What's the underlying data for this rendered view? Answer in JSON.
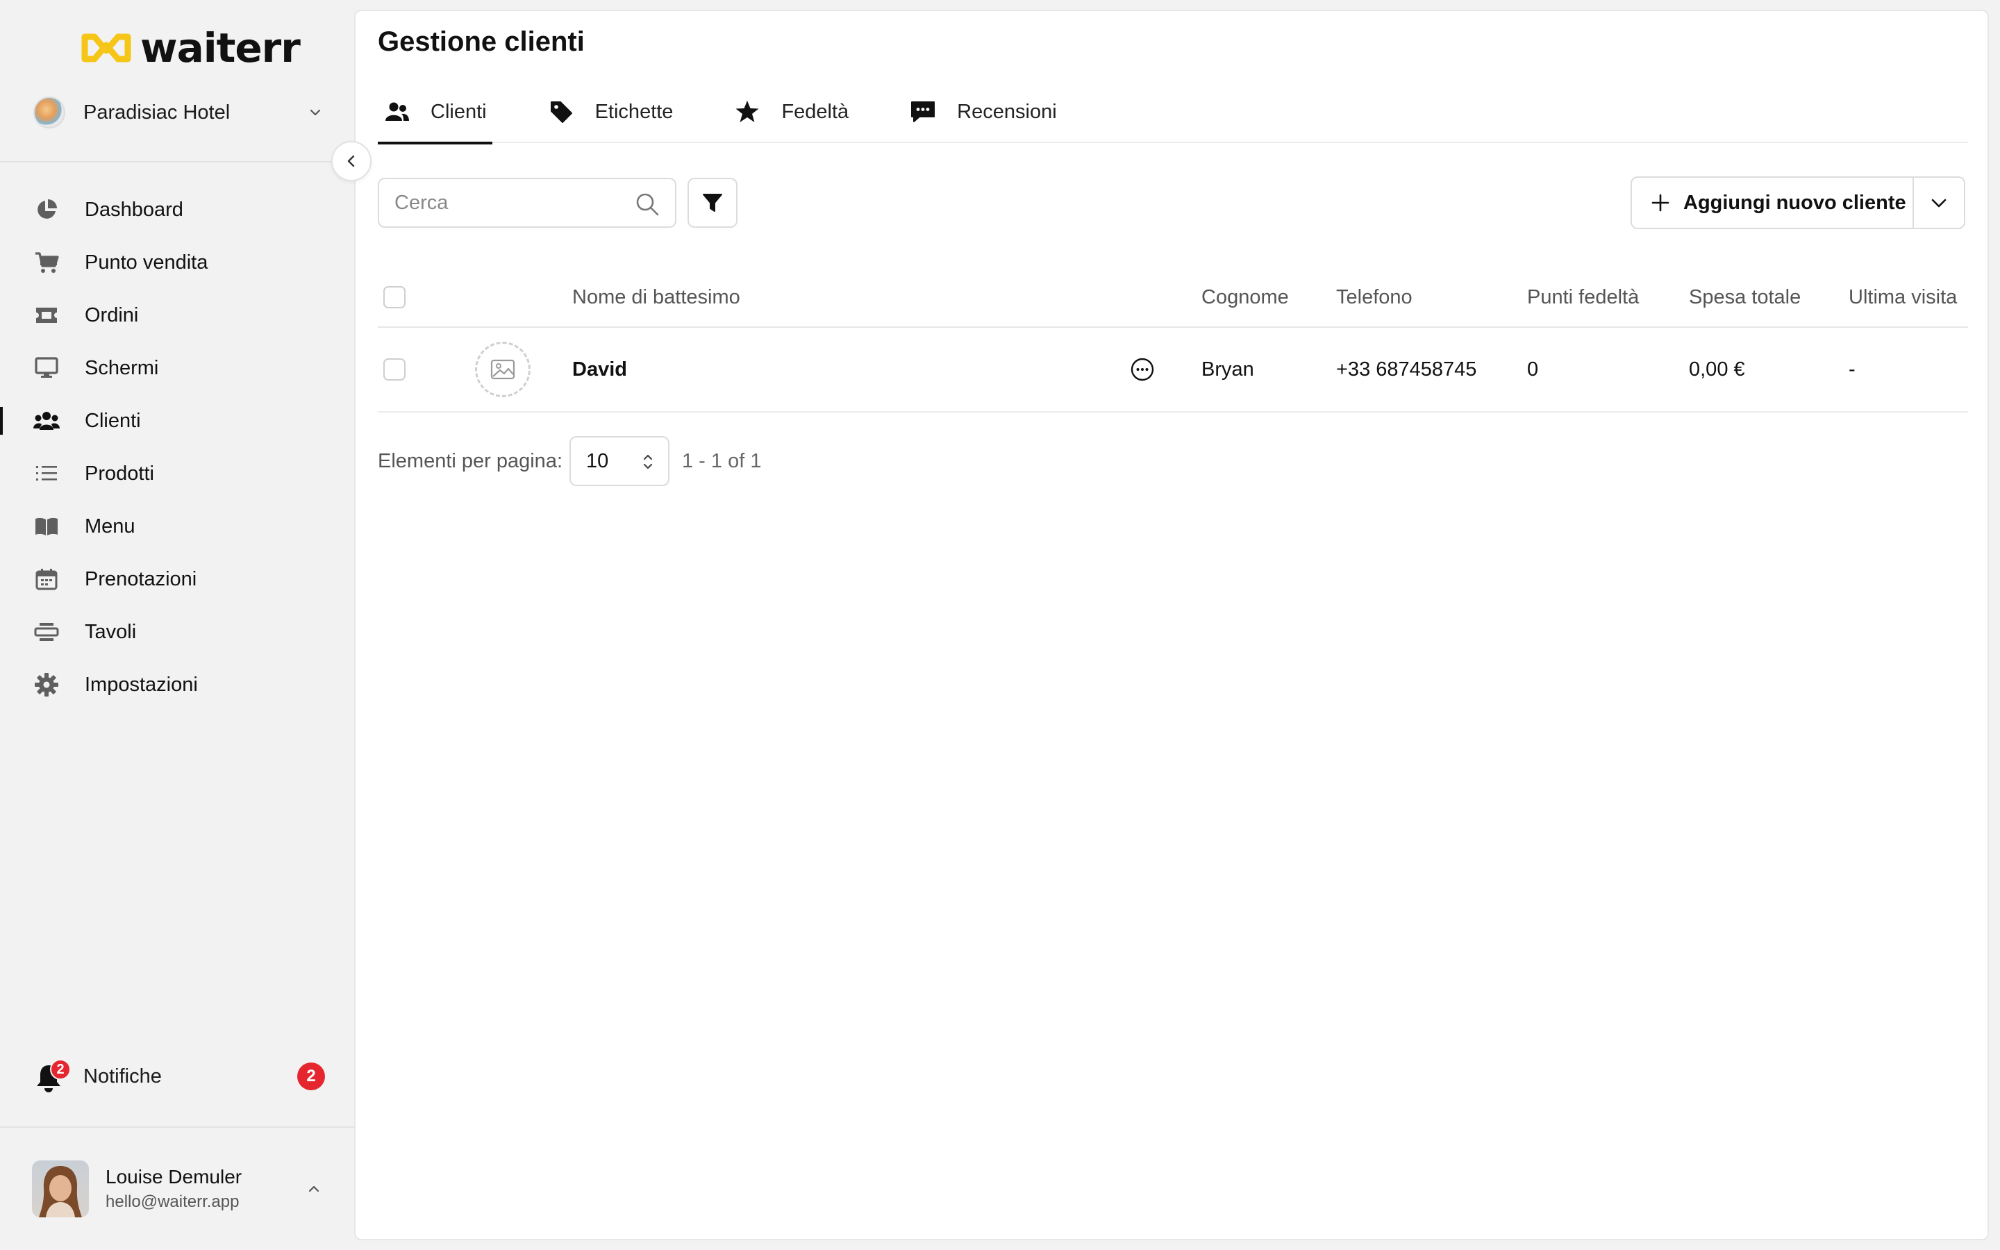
{
  "app": {
    "logo_text": "waiterr",
    "venue_name": "Paradisiac Hotel"
  },
  "sidebar": {
    "items": [
      {
        "label": "Dashboard",
        "icon": "pie-chart-icon"
      },
      {
        "label": "Punto vendita",
        "icon": "cart-icon"
      },
      {
        "label": "Ordini",
        "icon": "ticket-icon"
      },
      {
        "label": "Schermi",
        "icon": "monitor-icon"
      },
      {
        "label": "Clienti",
        "icon": "users-icon",
        "active": true
      },
      {
        "label": "Prodotti",
        "icon": "list-icon"
      },
      {
        "label": "Menu",
        "icon": "book-icon"
      },
      {
        "label": "Prenotazioni",
        "icon": "calendar-icon"
      },
      {
        "label": "Tavoli",
        "icon": "table-icon"
      },
      {
        "label": "Impostazioni",
        "icon": "gear-icon"
      }
    ],
    "notifications": {
      "label": "Notifiche",
      "count": "2"
    },
    "user": {
      "name": "Louise Demuler",
      "email": "hello@waiterr.app"
    }
  },
  "main": {
    "title": "Gestione clienti",
    "tabs": [
      {
        "label": "Clienti",
        "icon": "users-icon",
        "active": true
      },
      {
        "label": "Etichette",
        "icon": "tag-icon"
      },
      {
        "label": "Fedeltà",
        "icon": "star-icon"
      },
      {
        "label": "Recensioni",
        "icon": "chat-icon"
      }
    ],
    "search": {
      "placeholder": "Cerca",
      "value": ""
    },
    "add_button": "Aggiungi nuovo cliente",
    "table": {
      "columns": [
        "Nome di battesimo",
        "Cognome",
        "Telefono",
        "Punti fedeltà",
        "Spesa totale",
        "Ultima visita"
      ],
      "rows": [
        {
          "first_name": "David",
          "last_name": "Bryan",
          "phone": "+33 687458745",
          "points": "0",
          "total": "0,00 €",
          "last_visit": "-"
        }
      ]
    },
    "pagination": {
      "label": "Elementi per pagina:",
      "per_page": "10",
      "range": "1 - 1 of 1"
    }
  },
  "colors": {
    "accent": "#111111",
    "badge": "#e5262e",
    "logo_yellow": "#f5c518"
  }
}
